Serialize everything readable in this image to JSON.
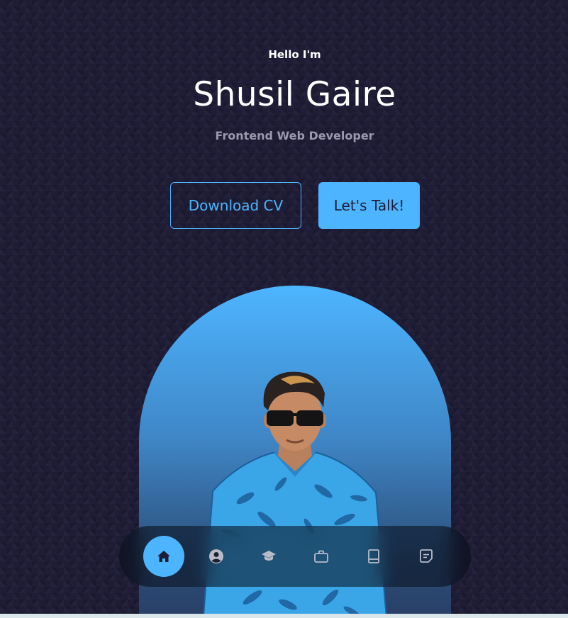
{
  "hero": {
    "greeting": "Hello I'm",
    "name": "Shusil Gaire",
    "role": "Frontend Web Developer"
  },
  "actions": {
    "download_cv": "Download CV",
    "lets_talk": "Let's Talk!"
  },
  "nav": {
    "items": [
      {
        "icon": "home-icon",
        "active": true
      },
      {
        "icon": "user-icon",
        "active": false
      },
      {
        "icon": "graduation-cap-icon",
        "active": false
      },
      {
        "icon": "briefcase-icon",
        "active": false
      },
      {
        "icon": "book-icon",
        "active": false
      },
      {
        "icon": "message-icon",
        "active": false
      }
    ]
  },
  "colors": {
    "background": "#1f1d36",
    "accent": "#4db5ff",
    "muted_text": "#9a99ad"
  }
}
